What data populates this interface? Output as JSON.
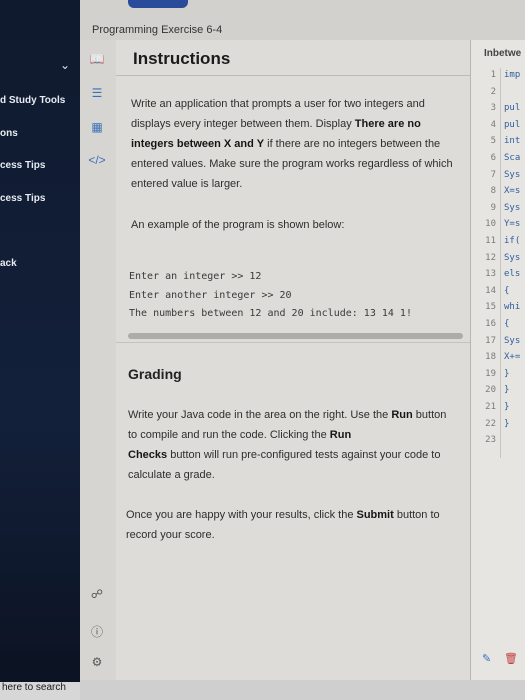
{
  "sidebar": {
    "items": [
      {
        "label": "d Study Tools"
      },
      {
        "label": "ons"
      },
      {
        "label": "cess Tips"
      },
      {
        "label": "cess Tips"
      },
      {
        "label": "ack"
      }
    ],
    "search_text": "here to search"
  },
  "header": {
    "exercise_title": "Programming Exercise 6-4"
  },
  "main": {
    "title": "Instructions",
    "para1_a": "Write an application that prompts a user for two integers and displays every integer between them. Display ",
    "para1_b": "There are no integers between X and Y",
    "para1_c": " if there are no integers between the entered values. Make sure the program works regardless of which entered value is larger.",
    "para2": "An example of the program is shown below:",
    "code_lines": [
      "Enter an integer >> 12",
      "Enter another integer >> 20",
      "The numbers between 12 and 20 include: 13 14 1!"
    ],
    "grading_title": "Grading",
    "grading_a": "Write your Java code in the area on the right. Use the ",
    "grading_run": "Run",
    "grading_b": " button to compile and run the code. Clicking the ",
    "grading_run2": "Run",
    "grading_checks": "Checks",
    "grading_c": " button will run pre-configured tests against your code to calculate a grade.",
    "submit_a": "Once you are happy with your results, click the ",
    "submit_b": "Submit",
    "submit_c": " button to record your score."
  },
  "editor": {
    "tab": "Inbetwe",
    "lines": [
      {
        "n": "1",
        "t": "imp"
      },
      {
        "n": "2",
        "t": ""
      },
      {
        "n": "3",
        "t": "pul"
      },
      {
        "n": "4",
        "t": "pul"
      },
      {
        "n": "5",
        "t": "int"
      },
      {
        "n": "6",
        "t": "Sca"
      },
      {
        "n": "7",
        "t": "Sys"
      },
      {
        "n": "8",
        "t": "X=s"
      },
      {
        "n": "9",
        "t": "Sys"
      },
      {
        "n": "10",
        "t": "Y=s"
      },
      {
        "n": "11",
        "t": "if("
      },
      {
        "n": "12",
        "t": "Sys"
      },
      {
        "n": "13",
        "t": "els"
      },
      {
        "n": "14",
        "t": "{"
      },
      {
        "n": "15",
        "t": "whi"
      },
      {
        "n": "16",
        "t": "{"
      },
      {
        "n": "17",
        "t": "Sys"
      },
      {
        "n": "18",
        "t": "X+="
      },
      {
        "n": "19",
        "t": "}"
      },
      {
        "n": "20",
        "t": "}"
      },
      {
        "n": "21",
        "t": "}"
      },
      {
        "n": "22",
        "t": "}"
      },
      {
        "n": "23",
        "t": ""
      }
    ]
  },
  "icons": {
    "book": "book-icon",
    "list": "list-icon",
    "chart": "chart-icon",
    "code": "code-icon",
    "share": "share-icon",
    "help": "help-icon",
    "settings": "settings-icon"
  }
}
